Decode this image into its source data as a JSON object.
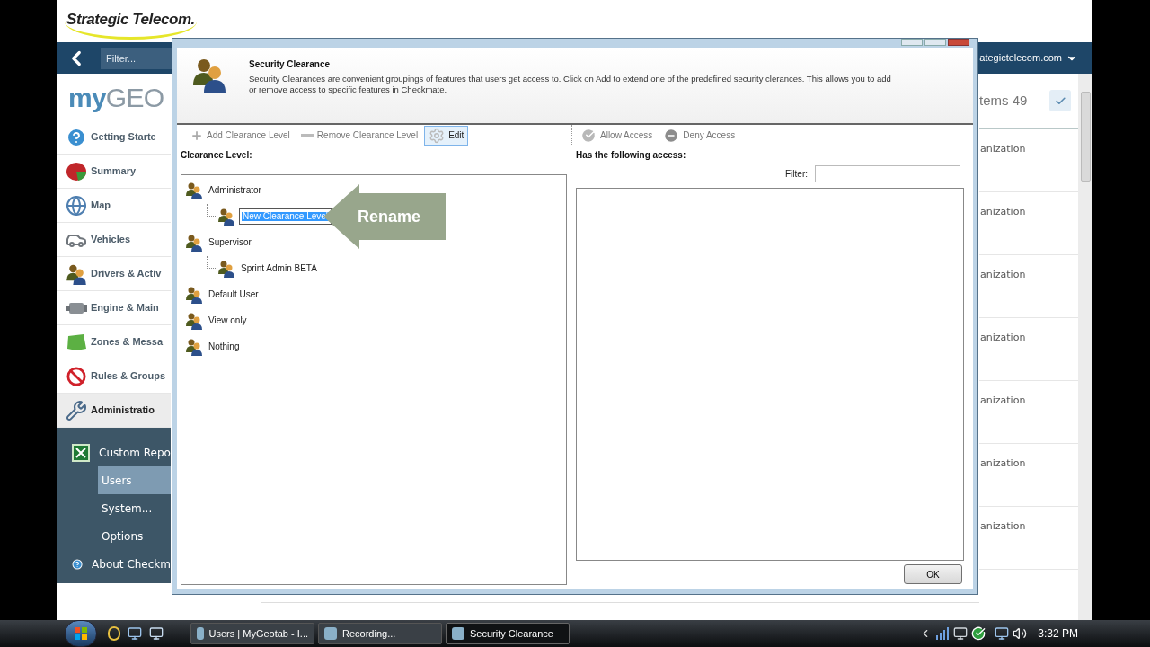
{
  "logo": {
    "text": "Strategic Telecom."
  },
  "nav": {
    "filter_placeholder": "Filter...",
    "account": "ategictelecom.com"
  },
  "brand": {
    "first": "my",
    "second": "GEO"
  },
  "sidebar": {
    "items": [
      {
        "label": "Getting Starte",
        "expanded": false
      },
      {
        "label": "Summary",
        "expanded": false
      },
      {
        "label": "Map",
        "expanded": false
      },
      {
        "label": "Vehicles",
        "expanded": false
      },
      {
        "label": "Drivers & Activ",
        "expanded": false
      },
      {
        "label": "Engine & Main",
        "expanded": false
      },
      {
        "label": "Zones & Messa",
        "expanded": false
      },
      {
        "label": "Rules & Groups",
        "expanded": false
      },
      {
        "label": "Administratio",
        "expanded": true,
        "children": [
          {
            "label": "Custom Repo",
            "kind": "report",
            "selected": false
          },
          {
            "label": "Users",
            "kind": "plain",
            "selected": true
          },
          {
            "label": "System...",
            "kind": "plain",
            "selected": false
          },
          {
            "label": "Options",
            "kind": "plain",
            "selected": false
          },
          {
            "label": "About Checkm",
            "kind": "about",
            "selected": false
          }
        ]
      }
    ]
  },
  "list": {
    "count": "tems 49",
    "rows": [
      "anization",
      "anization",
      "anization",
      "anization",
      "anization",
      "anization",
      "anization"
    ]
  },
  "dialog": {
    "heading": "Security Clearance",
    "description": "Security Clearances are convenient groupings of features that users get access to. Click on Add to extend one of the predefined security clerances. This allows you to add\nor remove access to specific features in Checkmate.",
    "left_tools": [
      {
        "label": "Add Clearance Level",
        "disabled": true,
        "pressed": false
      },
      {
        "label": "Remove Clearance Level",
        "disabled": true,
        "pressed": false
      },
      {
        "label": "Edit",
        "disabled": false,
        "pressed": true
      }
    ],
    "right_tools": [
      {
        "label": "Allow Access",
        "disabled": true,
        "pressed": false
      },
      {
        "label": "Deny Access",
        "disabled": true,
        "pressed": false
      }
    ],
    "clearance_label": "Clearance Level:",
    "tree": [
      {
        "label": "Administrator",
        "editing": false,
        "children": [
          {
            "label": "New Clearance Level",
            "editing": true
          }
        ]
      },
      {
        "label": "Supervisor",
        "editing": false,
        "children": [
          {
            "label": "Sprint Admin BETA",
            "editing": false
          }
        ]
      },
      {
        "label": "Default User",
        "editing": false
      },
      {
        "label": "View only",
        "editing": false
      },
      {
        "label": "Nothing",
        "editing": false
      }
    ],
    "annotation": "Rename",
    "access_label": "Has the following access:",
    "filter_label": "Filter:",
    "ok": "OK"
  },
  "taskbar": {
    "tasks": [
      {
        "label": "Users | MyGeotab - I...",
        "selected": false
      },
      {
        "label": "Recording...",
        "selected": false
      },
      {
        "label": "Security Clearance",
        "selected": true
      }
    ],
    "clock": "3:32 PM"
  }
}
